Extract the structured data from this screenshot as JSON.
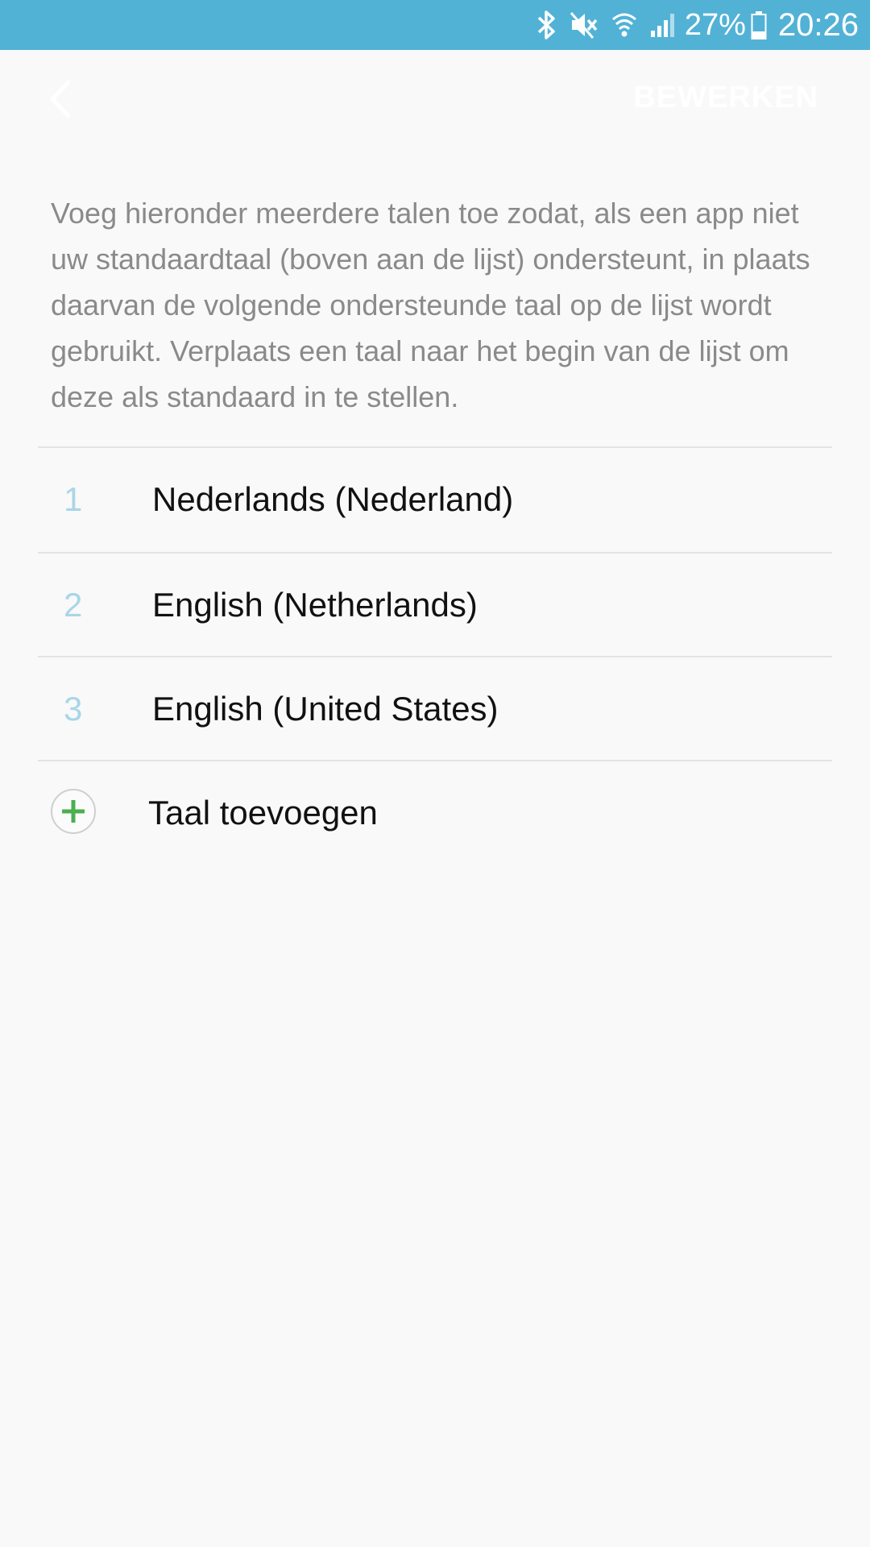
{
  "status_bar": {
    "icons": [
      "bluetooth-icon",
      "mute-icon",
      "wifi-icon",
      "signal-icon",
      "battery-icon"
    ],
    "battery": "27%",
    "time": "20:26",
    "background": "#52b2d6"
  },
  "app_bar": {
    "back_icon": "chevron-left-icon",
    "edit_label": "BEWERKEN"
  },
  "description": "Voeg hieronder meerdere talen toe zodat, als een app niet uw standaardtaal (boven aan de lijst) ondersteunt, in plaats daarvan de volgende ondersteunde taal op de lijst wordt gebruikt. Verplaats een taal naar het begin van de lijst om deze als standaard in te stellen.",
  "languages": [
    {
      "number": "1",
      "label": "Nederlands (Nederland)"
    },
    {
      "number": "2",
      "label": "English (Netherlands)"
    },
    {
      "number": "3",
      "label": "English (United States)"
    }
  ],
  "add_language": {
    "icon": "plus-icon",
    "label": "Taal toevoegen",
    "icon_color": "#4caf50"
  },
  "colors": {
    "number": "#a8d6e8",
    "description": "#8a8a8a",
    "divider": "#e3e3e3"
  }
}
